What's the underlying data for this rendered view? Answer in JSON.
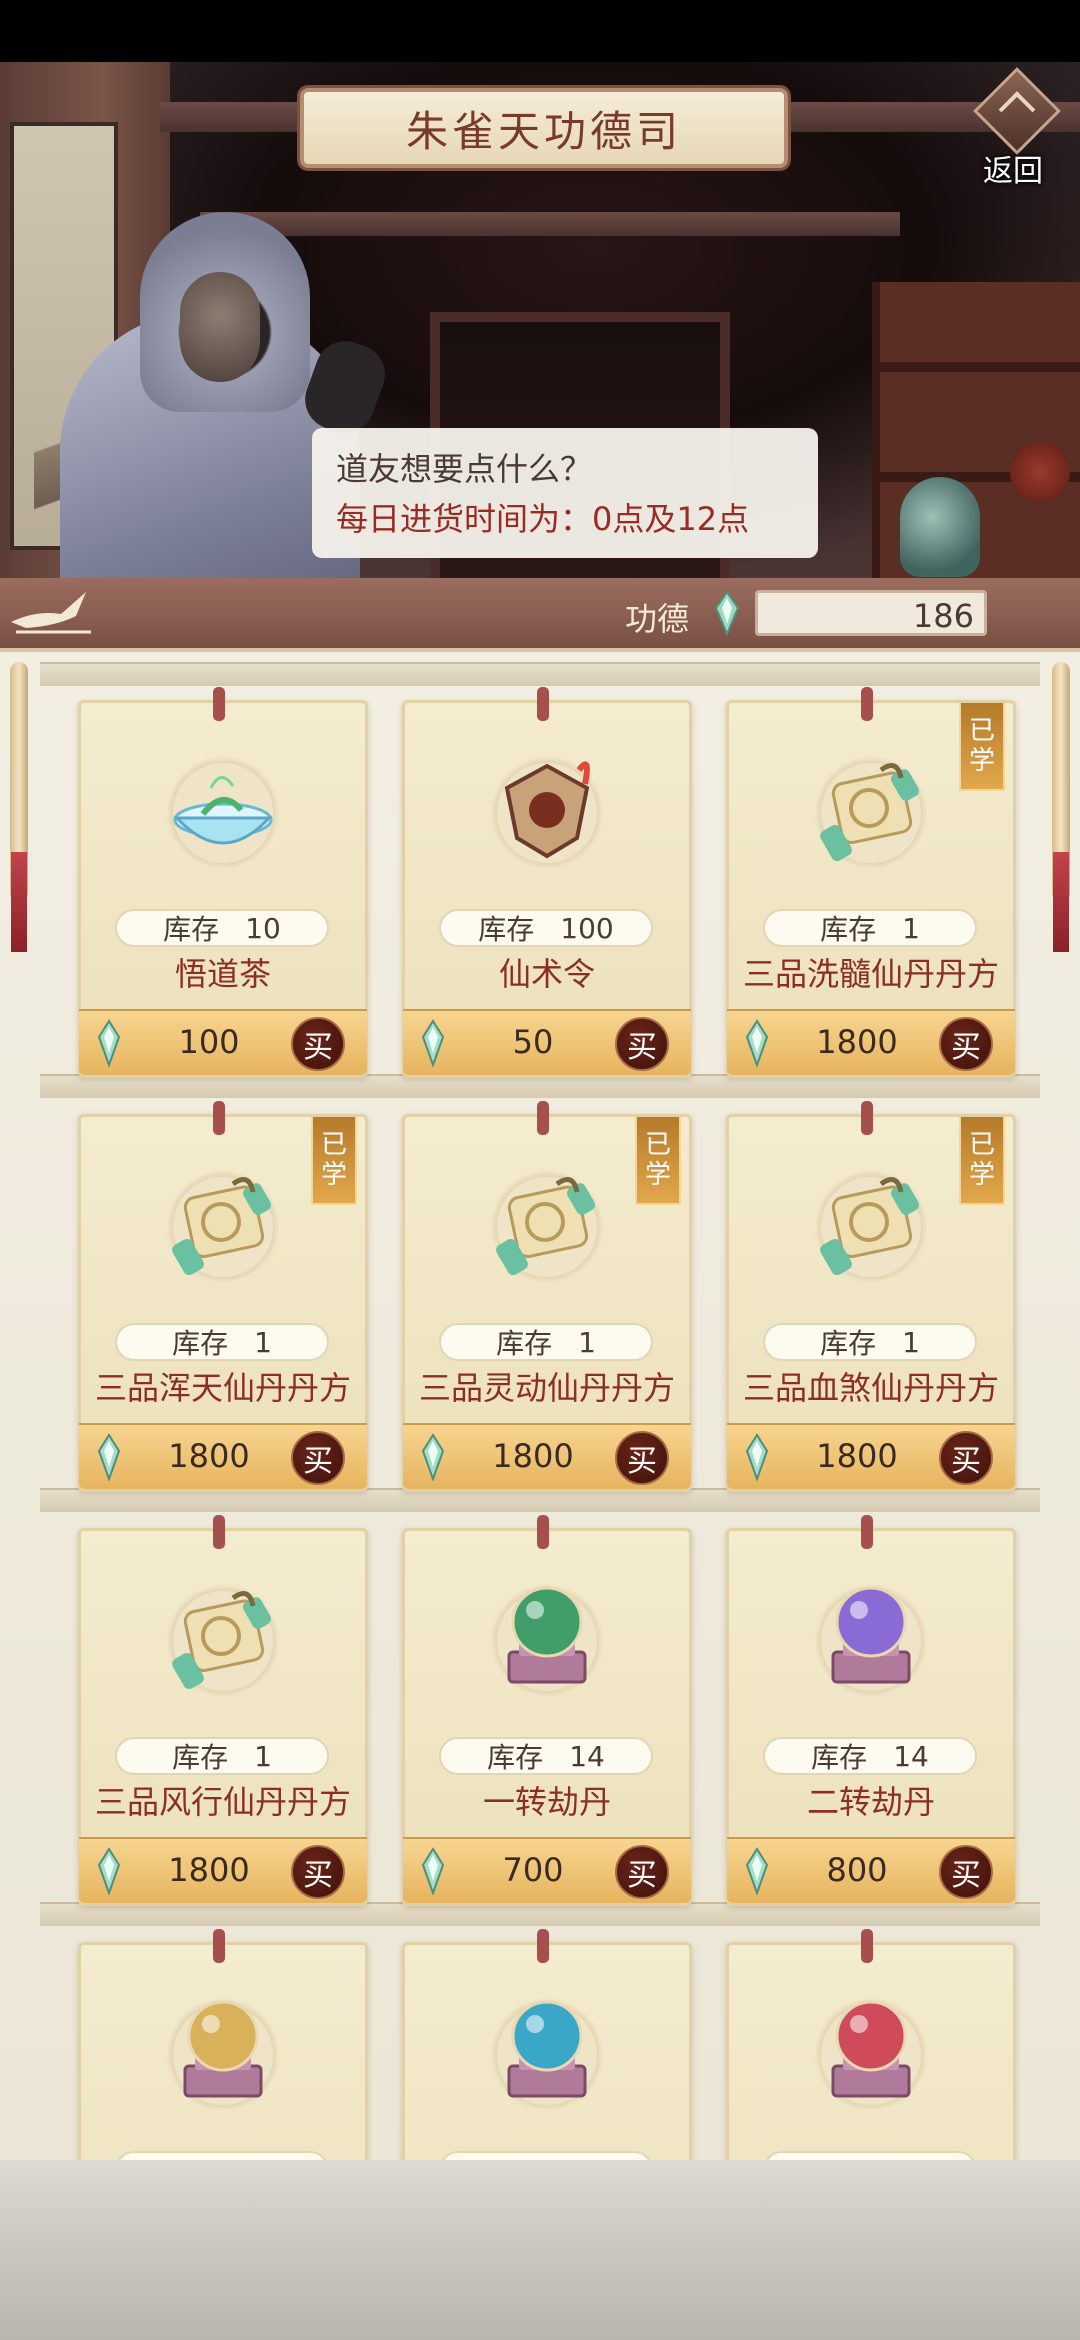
{
  "header": {
    "title": "朱雀天功德司",
    "back_label": "返回",
    "dialog_line1": "道友想要点什么？",
    "dialog_line2": "每日进货时间为：0点及12点"
  },
  "merit": {
    "label": "功德",
    "value": "186"
  },
  "shop": {
    "stock_label": "库存",
    "learned_badge": [
      "已",
      "学"
    ],
    "buy_label": "买",
    "items": [
      {
        "name": "悟道茶",
        "stock": "10",
        "price": "100",
        "icon": "tea-bowl-icon",
        "learned": false
      },
      {
        "name": "仙术令",
        "stock": "100",
        "price": "50",
        "icon": "token-icon",
        "learned": false
      },
      {
        "name": "三品洗髓仙丹丹方",
        "stock": "1",
        "price": "1800",
        "icon": "scroll-icon",
        "learned": true
      },
      {
        "name": "三品浑天仙丹丹方",
        "stock": "1",
        "price": "1800",
        "icon": "scroll-icon",
        "learned": true
      },
      {
        "name": "三品灵动仙丹丹方",
        "stock": "1",
        "price": "1800",
        "icon": "scroll-icon",
        "learned": true
      },
      {
        "name": "三品血煞仙丹丹方",
        "stock": "1",
        "price": "1800",
        "icon": "scroll-icon",
        "learned": true
      },
      {
        "name": "三品风行仙丹丹方",
        "stock": "1",
        "price": "1800",
        "icon": "scroll-icon",
        "learned": false
      },
      {
        "name": "一转劫丹",
        "stock": "14",
        "price": "700",
        "icon": "orb-icon",
        "orb_color": "#3f9e6a",
        "learned": false
      },
      {
        "name": "二转劫丹",
        "stock": "14",
        "price": "800",
        "icon": "orb-icon",
        "orb_color": "#8a6ad4",
        "learned": false
      },
      {
        "name": "",
        "stock": "",
        "price": "",
        "icon": "orb-icon",
        "orb_color": "#d8b15a",
        "learned": false
      },
      {
        "name": "",
        "stock": "",
        "price": "",
        "icon": "orb-icon",
        "orb_color": "#3aa7c9",
        "learned": false
      },
      {
        "name": "",
        "stock": "",
        "price": "",
        "icon": "orb-icon",
        "orb_color": "#cf4a5a",
        "learned": false
      }
    ]
  },
  "colors": {
    "accent_red": "#8c2f22",
    "price_gold": "#e6b45e",
    "badge_orange": "#e1a84c"
  }
}
